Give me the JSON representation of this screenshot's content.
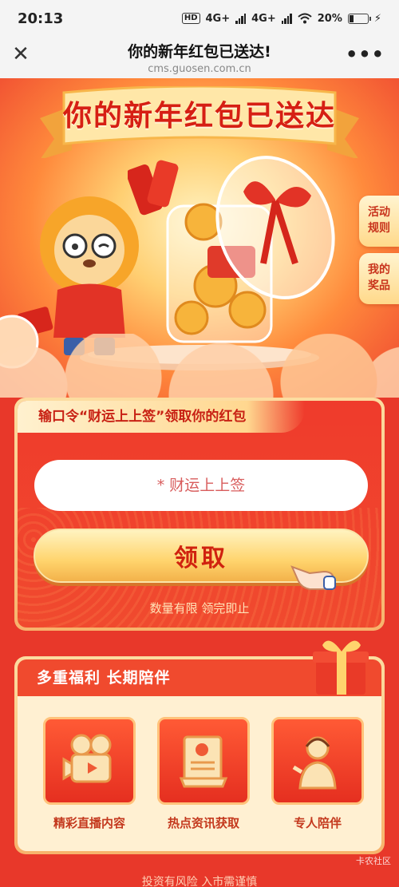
{
  "status_bar": {
    "time": "20:13",
    "hd_label": "HD",
    "net1": "4G+",
    "net2": "4G+",
    "battery": "20%"
  },
  "nav": {
    "title": "你的新年红包已送达!",
    "url": "cms.guosen.com.cn"
  },
  "hero": {
    "banner_text": "你的新年红包已送达",
    "side_tabs": [
      "活动\n规则",
      "我的\n奖品"
    ]
  },
  "code_card": {
    "header": "输口令“财运上上签”领取你的红包",
    "input_placeholder": "* 财运上上签",
    "input_value": "",
    "claim_button": "领取",
    "limited_note": "数量有限 领完即止"
  },
  "benefits": {
    "title": "多重福利  长期陪伴",
    "items": [
      {
        "label": "精彩直播内容",
        "icon": "video-camera-icon"
      },
      {
        "label": "热点资讯获取",
        "icon": "news-scroll-icon"
      },
      {
        "label": "专人陪伴",
        "icon": "advisor-headset-icon"
      }
    ]
  },
  "footer": {
    "risk_note": "投资有风险 入市需谨慎",
    "watermark": "卡农社区"
  },
  "colors": {
    "accent_red": "#e8382a",
    "gold": "#ffd46d",
    "title_red": "#d61f14"
  }
}
